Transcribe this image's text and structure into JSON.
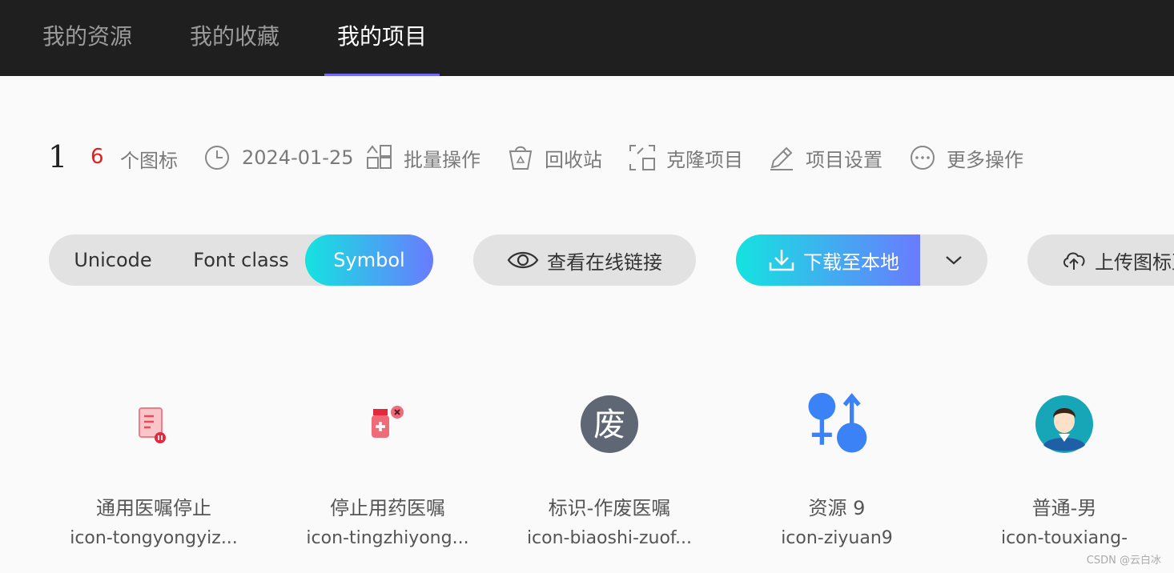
{
  "tabs": [
    {
      "label": "我的资源",
      "active": false
    },
    {
      "label": "我的收藏",
      "active": false
    },
    {
      "label": "我的项目",
      "active": true
    }
  ],
  "project": {
    "name": "1",
    "icon_count": "6",
    "icon_count_label": "个图标",
    "date": "2024-01-25",
    "actions": [
      {
        "label": "批量操作",
        "icon": "batch-icon"
      },
      {
        "label": "回收站",
        "icon": "recycle-bin-icon"
      },
      {
        "label": "克隆项目",
        "icon": "clone-icon"
      },
      {
        "label": "项目设置",
        "icon": "edit-icon"
      },
      {
        "label": "更多操作",
        "icon": "more-icon"
      }
    ]
  },
  "format_tabs": {
    "unicode": "Unicode",
    "font_class": "Font class",
    "symbol": "Symbol",
    "selected": "Symbol"
  },
  "buttons": {
    "view_link": "查看在线链接",
    "download": "下载至本地",
    "upload": "上传图标至"
  },
  "icons": [
    {
      "name": "通用医嘱停止",
      "code": "icon-tongyongyiz...",
      "icon": "medical-order-stop-icon"
    },
    {
      "name": "停止用药医嘱",
      "code": "icon-tingzhiyong...",
      "icon": "medicine-bottle-stop-icon"
    },
    {
      "name": "标识-作废医嘱",
      "code": "icon-biaoshi-zuof...",
      "icon": "void-badge-icon",
      "glyph_text": "废"
    },
    {
      "name": "资源 9",
      "code": "icon-ziyuan9",
      "icon": "gender-symbols-icon"
    },
    {
      "name": "普通-男",
      "code": "icon-touxiang-",
      "icon": "male-avatar-icon"
    }
  ],
  "colors": {
    "accent": "#6e6af7",
    "gradient_start": "#14e3e0",
    "gradient_end": "#6a7bff",
    "topbar": "#1f1f1f",
    "count_red": "#e0201e"
  },
  "watermark": "CSDN @云白冰"
}
